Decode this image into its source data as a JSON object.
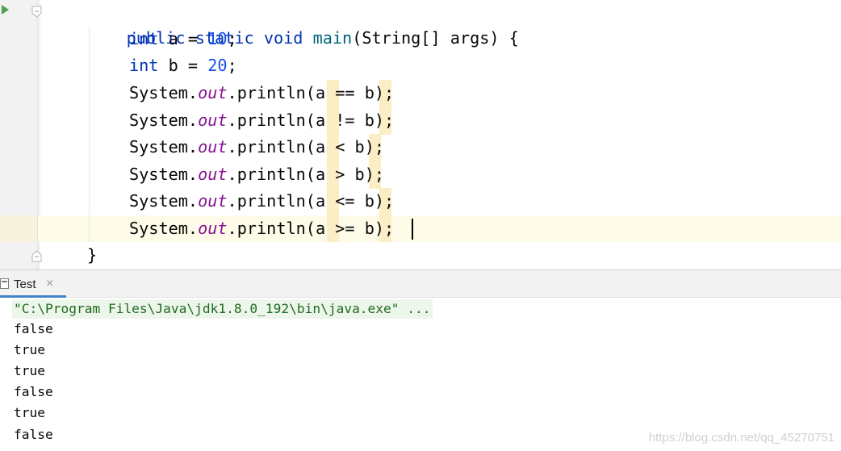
{
  "editor": {
    "method_signature": {
      "mod1": "public",
      "mod2": "static",
      "ret": "void",
      "name": "main",
      "params": "(String[] args) {"
    },
    "decls": [
      {
        "type": "int",
        "var": "a",
        "op": " = ",
        "value": "10",
        "end": ";"
      },
      {
        "type": "int",
        "var": "b",
        "op": " = ",
        "value": "20",
        "end": ";"
      }
    ],
    "prints": [
      {
        "prefix": "System.",
        "field": "out",
        "method": ".println(",
        "expr": "a == b",
        "end": ");"
      },
      {
        "prefix": "System.",
        "field": "out",
        "method": ".println(",
        "expr": "a != b",
        "end": ");"
      },
      {
        "prefix": "System.",
        "field": "out",
        "method": ".println(",
        "expr": "a < b",
        "end": ");"
      },
      {
        "prefix": "System.",
        "field": "out",
        "method": ".println(",
        "expr": "a > b",
        "end": ");"
      },
      {
        "prefix": "System.",
        "field": "out",
        "method": ".println(",
        "expr": "a <= b",
        "end": ");"
      },
      {
        "prefix": "System.",
        "field": "out",
        "method": ".println(",
        "expr": "a >= b",
        "end": ");"
      }
    ],
    "closing_brace": "}"
  },
  "run_panel": {
    "tab_label": "Test",
    "close_glyph": "×",
    "command": "\"C:\\Program Files\\Java\\jdk1.8.0_192\\bin\\java.exe\" ...",
    "output": [
      "false",
      "true",
      "true",
      "false",
      "true",
      "false"
    ]
  },
  "watermark": "https://blog.csdn.net/qq_45270751",
  "colors": {
    "keyword": "#0033b3",
    "method_name": "#00627a",
    "number": "#1750eb",
    "static_field": "#871094",
    "paren_highlight": "#fbedc4",
    "run_icon": "#4f9e4f"
  }
}
